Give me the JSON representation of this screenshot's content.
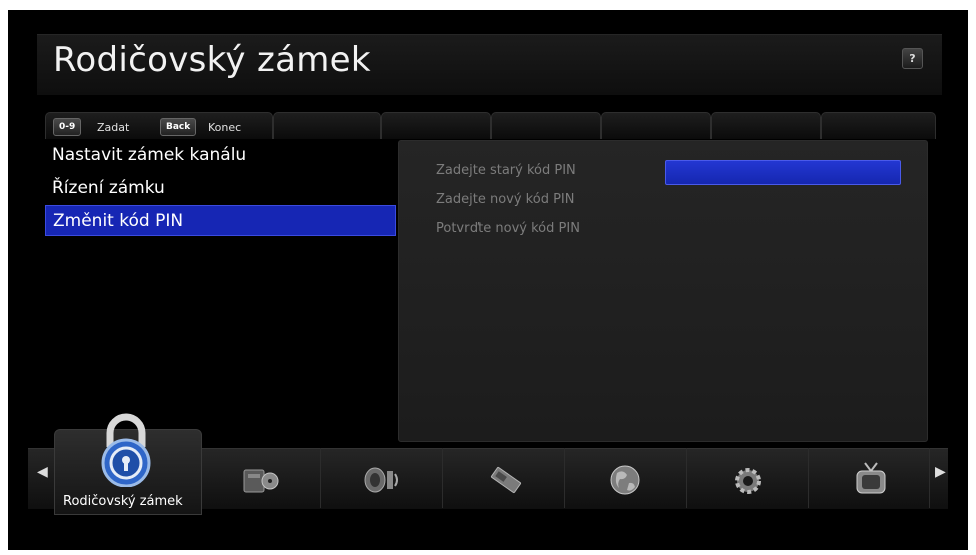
{
  "header": {
    "title": "Rodičovský zámek",
    "help_label": "?"
  },
  "hints": [
    {
      "key": "0-9",
      "label": "Zadat"
    },
    {
      "key": "Back",
      "label": "Konec"
    }
  ],
  "menu": {
    "items": [
      {
        "label": "Nastavit zámek kanálu"
      },
      {
        "label": "Řízení zámku"
      },
      {
        "label": "Změnit kód PIN"
      }
    ],
    "selected_index": 2
  },
  "form": {
    "fields": [
      {
        "label": "Zadejte starý kód PIN",
        "value": ""
      },
      {
        "label": "Zadejte nový kód PIN",
        "value": ""
      },
      {
        "label": "Potvrďte nový kód PIN",
        "value": ""
      }
    ]
  },
  "dock": {
    "active_label": "Rodičovský zámek",
    "items": [
      "padlock-icon",
      "media-icon",
      "speaker-icon",
      "usb-icon",
      "globe-icon",
      "gear-icon",
      "tv-icon"
    ],
    "left_arrow": "◀",
    "right_arrow": "▶"
  },
  "colors": {
    "selection": "#1626b4",
    "background": "#000000",
    "panel": "#222222"
  }
}
